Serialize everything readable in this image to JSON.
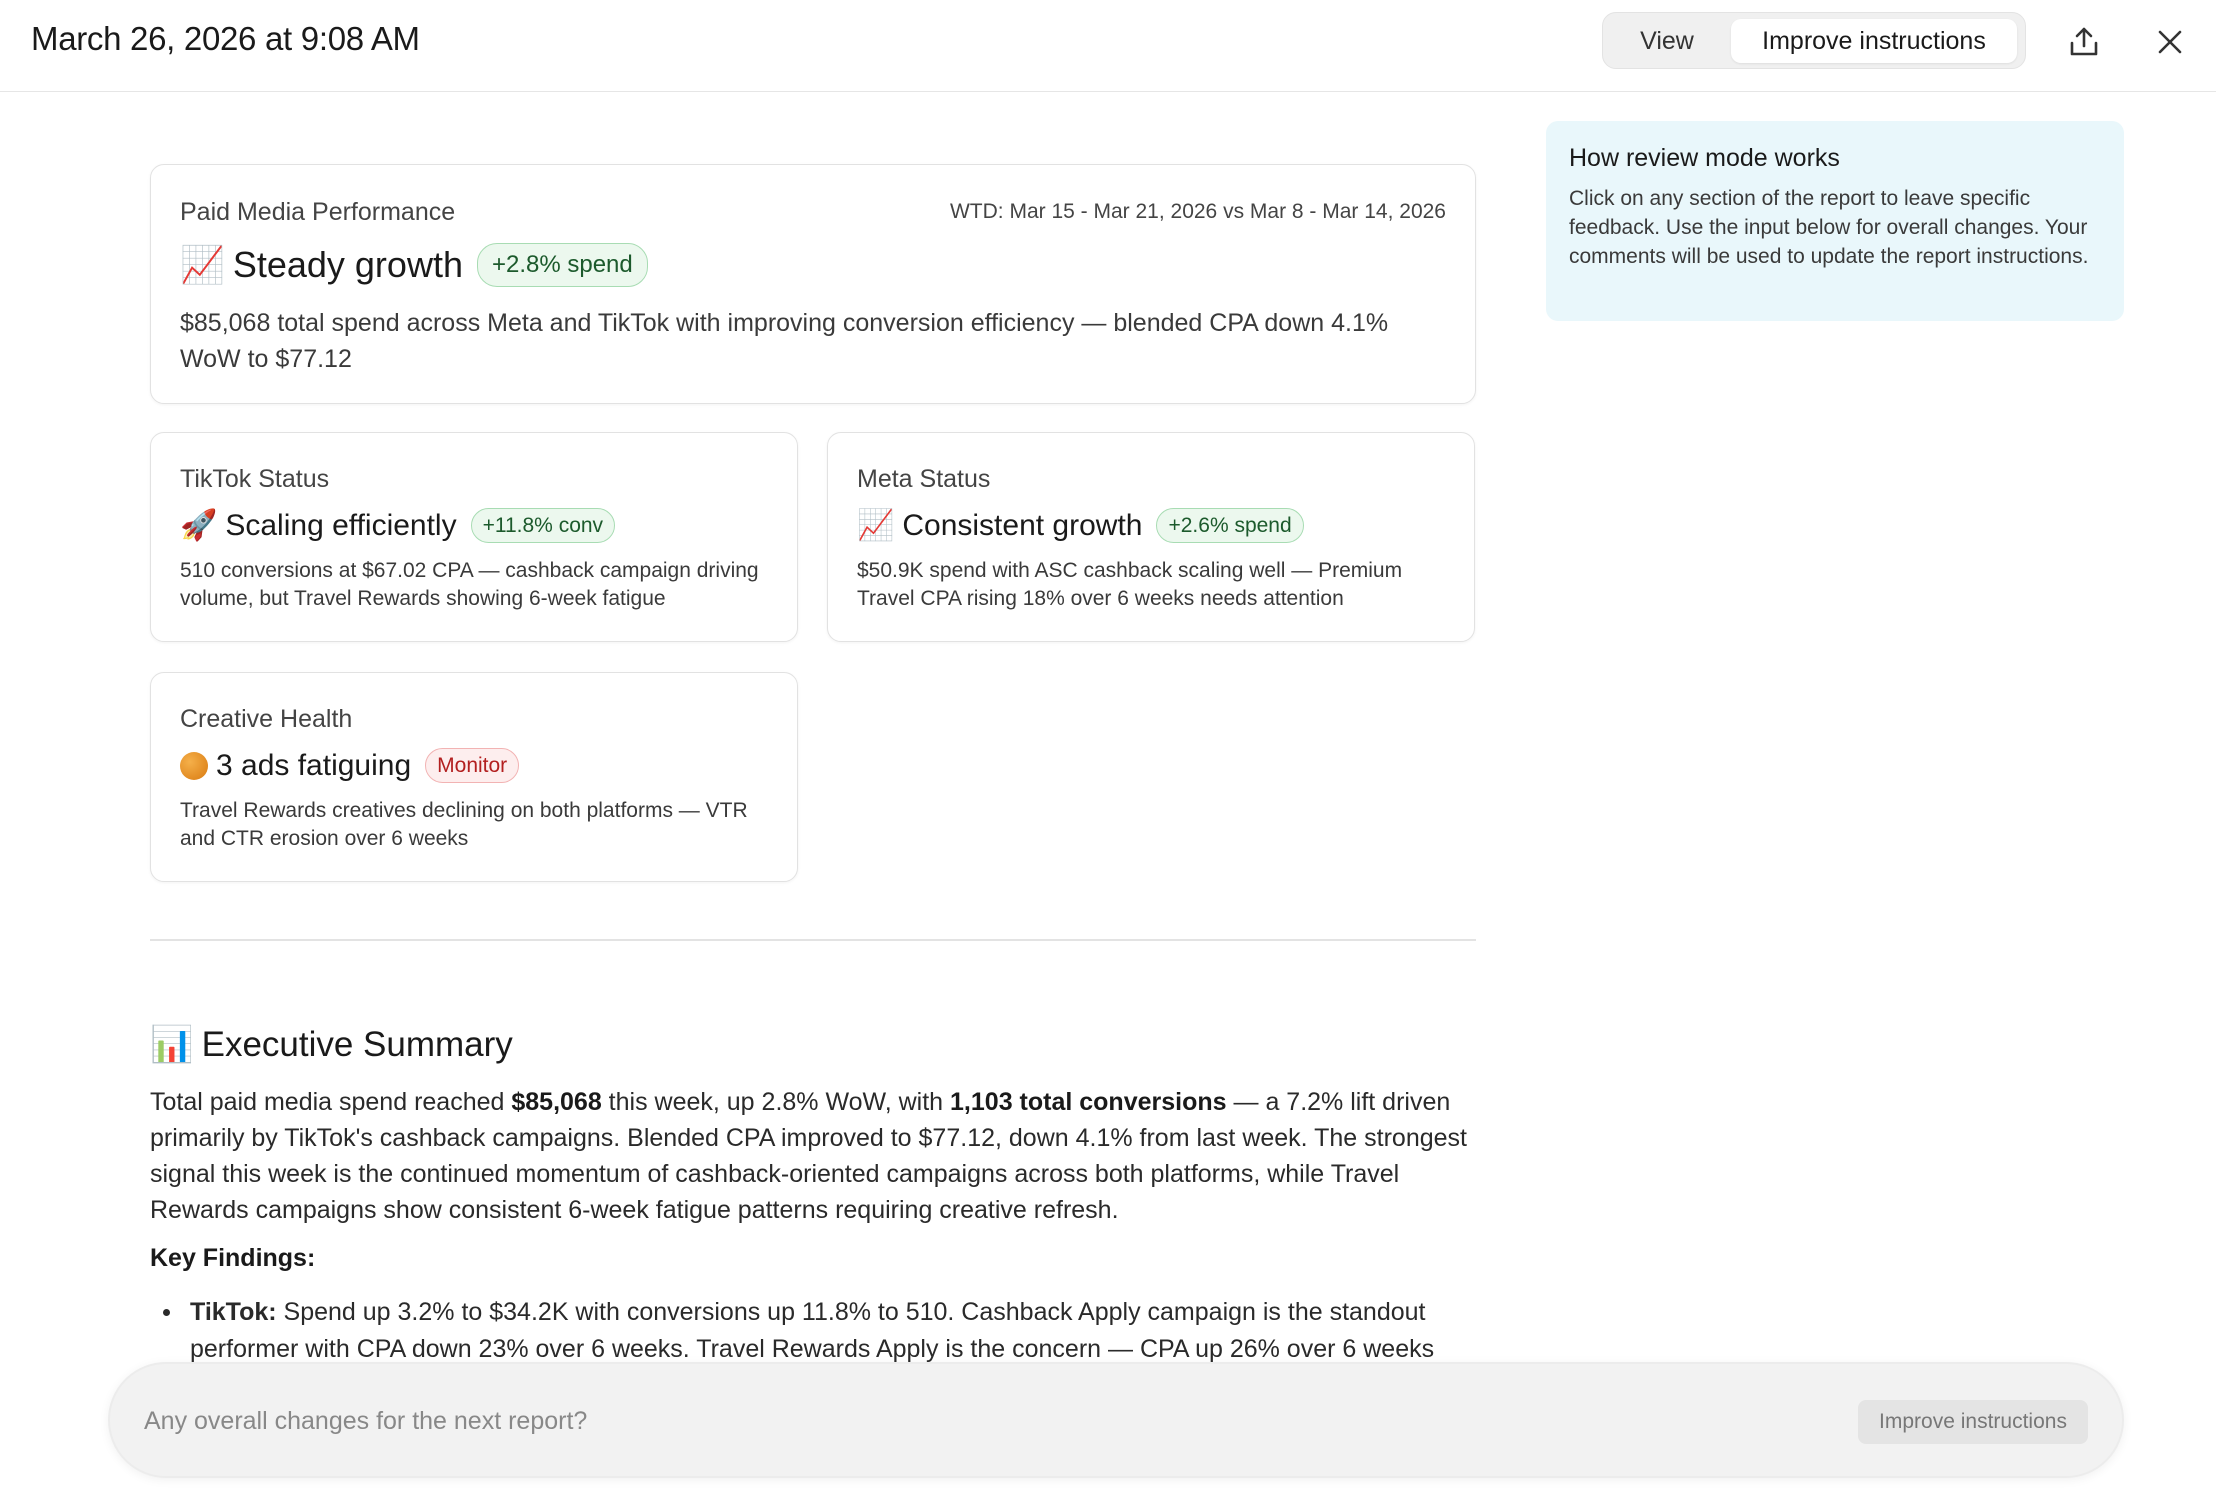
{
  "header": {
    "title": "March 26, 2026 at 9:08 AM",
    "tabs": [
      {
        "label": "View"
      },
      {
        "label": "Improve instructions"
      }
    ]
  },
  "main_card": {
    "label": "Paid Media Performance",
    "date_range": "WTD: Mar 15 - Mar 21, 2026 vs Mar 8 - Mar 14, 2026",
    "emoji": "📈",
    "status": "Steady growth",
    "pill": "+2.8% spend",
    "description": "$85,068 total spend across Meta and TikTok with improving conversion efficiency — blended CPA down 4.1% WoW to $77.12"
  },
  "tiktok_card": {
    "label": "TikTok Status",
    "emoji": "🚀",
    "status": "Scaling efficiently",
    "pill": "+11.8% conv",
    "description": "510 conversions at $67.02 CPA — cashback campaign driving volume, but Travel Rewards showing 6-week fatigue"
  },
  "meta_card": {
    "label": "Meta Status",
    "emoji": "📈",
    "status": "Consistent growth",
    "pill": "+2.6% spend",
    "description": "$50.9K spend with ASC cashback scaling well — Premium Travel CPA rising 18% over 6 weeks needs attention"
  },
  "creative_card": {
    "label": "Creative Health",
    "status": "3 ads fatiguing",
    "pill": "Monitor",
    "description": "Travel Rewards creatives declining on both platforms — VTR and CTR erosion over 6 weeks"
  },
  "executive_summary": {
    "emoji": "📊",
    "heading": "Executive Summary",
    "p1_a": "Total paid media spend reached ",
    "p1_b": "$85,068",
    "p1_c": " this week, up 2.8% WoW, with ",
    "p1_d": "1,103 total conversions",
    "p1_e": " — a 7.2% lift driven primarily by TikTok's cashback campaigns. Blended CPA improved to $77.12, down 4.1% from last week. The strongest signal this week is the continued momentum of cashback-oriented campaigns across both platforms, while Travel Rewards campaigns show consistent 6-week fatigue patterns requiring creative refresh.",
    "key_findings_label": "Key Findings:",
    "bullets": [
      {
        "lead": "TikTok:",
        "text": " Spend up 3.2% to $34.2K with conversions up 11.8% to 510. Cashback Apply campaign is the standout performer with CPA down 23% over 6 weeks. Travel Rewards Apply is the concern — CPA up 26% over 6 weeks"
      }
    ]
  },
  "review_panel": {
    "title": "How review mode works",
    "body": "Click on any section of the report to leave specific feedback. Use the input below for overall changes. Your comments will be used to update the report instructions."
  },
  "bottom_bar": {
    "placeholder": "Any overall changes for the next report?",
    "button_label": "Improve instructions"
  }
}
